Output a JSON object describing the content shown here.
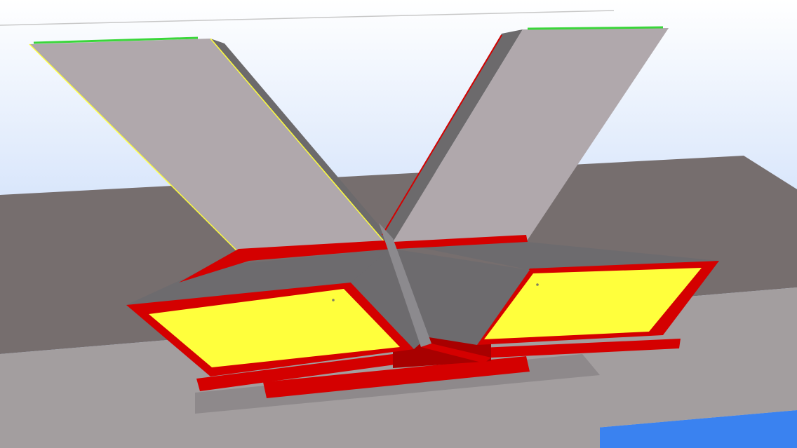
{
  "colors": {
    "sky_top": "#ffffff",
    "sky_bottom": "#a8c6f6",
    "blue_plane": "#3a82f0",
    "wall_dark": "#766e6e",
    "wall_light": "#a39e9f",
    "plate_surface": "#b0a8ac",
    "plate_edge": "#6c6a6c",
    "gusset_dark": "#6d6b6e",
    "steel_red": "#d40000",
    "steel_red_dark": "#a80000",
    "highlight_yellow": "#ffff3c",
    "edge_green": "#3ad63a"
  }
}
